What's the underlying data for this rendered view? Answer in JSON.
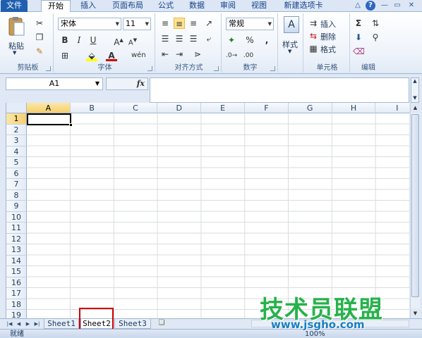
{
  "tabs": [
    {
      "label": "文件"
    },
    {
      "label": "开始"
    },
    {
      "label": "插入"
    },
    {
      "label": "页面布局"
    },
    {
      "label": "公式"
    },
    {
      "label": "数据"
    },
    {
      "label": "审阅"
    },
    {
      "label": "视图"
    },
    {
      "label": "新建选项卡"
    }
  ],
  "ribbon": {
    "clipboard": {
      "label": "剪贴板",
      "paste": "粘贴"
    },
    "font": {
      "label": "字体",
      "name": "宋体",
      "size": "11"
    },
    "alignment": {
      "label": "对齐方式"
    },
    "number": {
      "label": "数字",
      "format": "常规"
    },
    "styles": {
      "label": "样式"
    },
    "cells": {
      "label": "单元格",
      "insert": "插入",
      "delete": "删除",
      "format": "格式"
    },
    "editing": {
      "label": "编辑"
    }
  },
  "formula_bar": {
    "name_box": "A1",
    "fx": "fx",
    "value": ""
  },
  "grid": {
    "columns": [
      "A",
      "B",
      "C",
      "D",
      "E",
      "F",
      "G",
      "H",
      "I"
    ],
    "rows": [
      "1",
      "2",
      "3",
      "4",
      "5",
      "6",
      "7",
      "8",
      "9",
      "10",
      "11",
      "12",
      "13",
      "14",
      "15",
      "16",
      "17",
      "18",
      "19"
    ],
    "active_cell": "A1"
  },
  "sheets": [
    {
      "label": "Sheet1"
    },
    {
      "label": "Sheet2"
    },
    {
      "label": "Sheet3"
    }
  ],
  "active_sheet": "Sheet2",
  "status": {
    "ready": "就绪",
    "zoom": "100%"
  },
  "watermark": {
    "main": "技术员联盟",
    "sub": "www.jsgho.com"
  },
  "colors": {
    "file_tab": "#1f5fb0",
    "highlight": "#d00000",
    "watermark_green": "#27b24b",
    "watermark_blue": "#1b7ec2"
  }
}
